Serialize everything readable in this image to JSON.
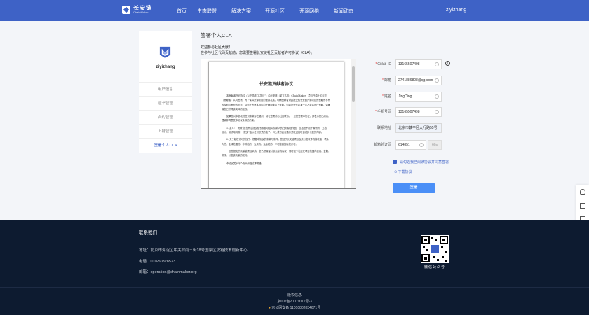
{
  "header": {
    "logo_cn": "长安链",
    "logo_en": "ChainMaker",
    "nav": [
      "首页",
      "生态联盟",
      "解决方案",
      "开源社区",
      "开源网络",
      "新闻动态"
    ],
    "user": "ziyizhang"
  },
  "sidebar": {
    "username": "ziyizhang",
    "items": [
      "用户信息",
      "证书管理",
      "合约管理",
      "上链管理",
      "签署个人CLA"
    ],
    "active_index": 4
  },
  "main": {
    "title": "签署个人CLA",
    "welcome": "欢迎参与社区贡献！",
    "notice": "在参与社区代码贡献前，您需要签署长安链社区贡献者许可协议（CLA）。"
  },
  "doc": {
    "title": "长安链贡献者协议",
    "paragraphs": [
      "本贡献者许可协议（以下简称“本协议”）由长安链（英文名称：ChainMaker）项目开源社区与您（贡献者）共同签署。为了保障开源项目的健康发展，明确贡献者对其提交给长安链开源项目的贡献所享有的权利与承担的义务，请您在签署本协议前仔细阅读以下条款。如果您是代表某一法人实体进行贡献，请确保您已获得该实体的授权。",
      "如果您对本协议的任何条款存在疑问，请在签署前与社区联系。一旦您签署本协议，即表示您已阅读、理解并同意受本协议条款的约束。",
      "1. 定义：“贡献”指您有意提交给长安链项目以供纳入的任何原创作品，包括但不限于源代码、文档、设计、测试用例等；“提交”指以任何形式的电子、口头或书面沟通方式发送给项目或其代表的内容。",
      "2. 关于版权许可的授予：根据本协议的条款与条件，您授予长安链项目及其分发软件的接收者一项永久的、全球范围的、非排他的、免费的、免版税的、不可撤销的版权许可。",
      "一旦您提交的贡献被项目采纳，您仍然保留对该贡献的版权，同时授予社区在项目范围内使用、复制、修改、分发该贡献的权利。",
      "本协议受中华人民共和国法律管辖。"
    ]
  },
  "form": {
    "fields": [
      {
        "label": "Gitlab-ID",
        "value": "13165507498",
        "required": true
      },
      {
        "label": "邮箱",
        "value": "2741886808@qq.com",
        "required": true
      },
      {
        "label": "姓名",
        "value": "JingDing",
        "required": true
      },
      {
        "label": "手机号码",
        "value": "13165507498",
        "required": true
      },
      {
        "label": "联系地址",
        "value": "北京市藕平区大行路55号",
        "required": false
      },
      {
        "label": "邮箱验证码",
        "value": "614851",
        "required": false
      }
    ],
    "code_button": "60s",
    "agree_text": "请勾选我已阅读协议并同意签署",
    "download": "下载协议",
    "submit": "签署"
  },
  "footer": {
    "contact_title": "联系我们",
    "address": "地址：北京市海淀区中关村南三街18号国家区块链技术创新中心",
    "phone": "电话：010-50828533",
    "email": "邮箱：operation@chainmaker.org",
    "qr_caption": "微信公众号",
    "record_title": "版权信息",
    "icp": "京ICP备20019011号-3",
    "police": "京公网安备 11010802034671号"
  },
  "colors": {
    "brand": "#3e62c6",
    "footer_bg": "#0d1b30",
    "button": "#4a8ff7"
  }
}
